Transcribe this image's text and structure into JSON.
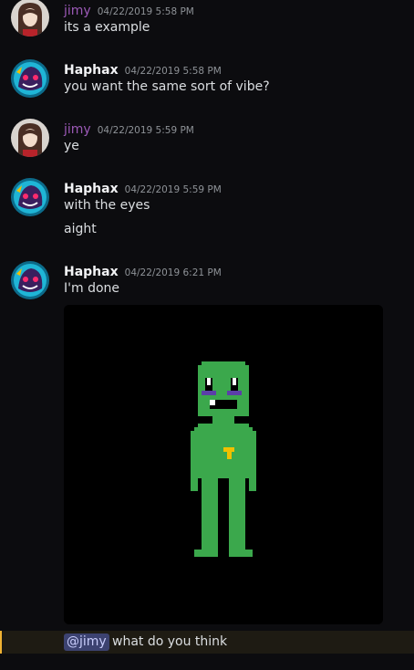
{
  "colors": {
    "background": "#0c0c0f",
    "jimy_name": "#9b59b6",
    "haphax_name": "#f2f3f5",
    "timestamp": "#8e9297",
    "mention_bg": "#3c4270",
    "mention_row_bg": "#1e1b13",
    "figure_green": "#3ba84c",
    "badge_yellow": "#f0c000"
  },
  "messages": [
    {
      "author": "jimy",
      "timestamp": "04/22/2019 5:58 PM",
      "lines": [
        "its a example"
      ],
      "avatar_icon": "anime-girl-avatar-icon"
    },
    {
      "author": "Haphax",
      "timestamp": "04/22/2019 5:58 PM",
      "lines": [
        "you want the same sort of vibe?"
      ],
      "avatar_icon": "purple-creature-avatar-icon"
    },
    {
      "author": "jimy",
      "timestamp": "04/22/2019 5:59 PM",
      "lines": [
        "ye"
      ],
      "avatar_icon": "anime-girl-avatar-icon"
    },
    {
      "author": "Haphax",
      "timestamp": "04/22/2019 5:59 PM",
      "lines": [
        "with the eyes",
        "aight"
      ],
      "avatar_icon": "purple-creature-avatar-icon"
    },
    {
      "author": "Haphax",
      "timestamp": "04/22/2019 6:21 PM",
      "lines": [
        "I'm done"
      ],
      "avatar_icon": "purple-creature-avatar-icon",
      "attachment": "green-pixel-character-image"
    }
  ],
  "reply": {
    "mention": "@jimy",
    "text": "what do you think"
  }
}
